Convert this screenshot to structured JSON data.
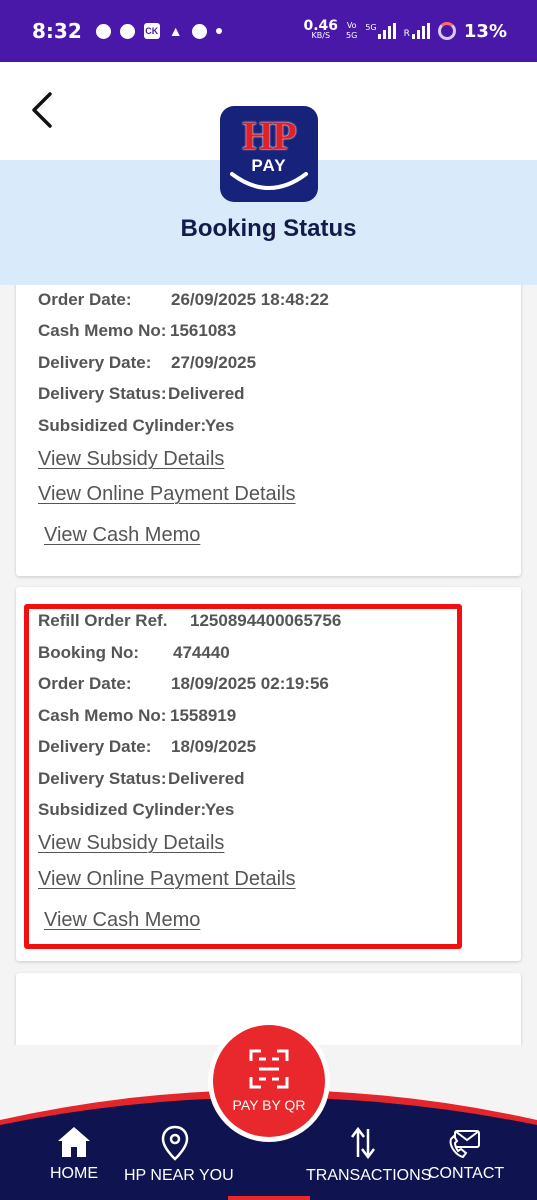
{
  "status_bar": {
    "time": "8:32",
    "speed_value": "0.46",
    "speed_unit": "KB/S",
    "vo_top": "Vo",
    "vo_bottom": "5G",
    "net_label": "5G",
    "roaming": "R",
    "battery": "13%",
    "notif_icons": [
      "chat-icon",
      "facebook-icon",
      "ck-app-icon",
      "drive-icon",
      "bag-icon"
    ]
  },
  "header": {
    "logo_top": "HP",
    "logo_bottom": "PAY",
    "title": "Booking Status"
  },
  "cards": [
    {
      "rows": [
        {
          "label": "Order Date:",
          "value": "26/09/2025 18:48:22"
        },
        {
          "label": "Cash Memo No:",
          "value": "1561083"
        },
        {
          "label": "Delivery Date:",
          "value": "27/09/2025"
        },
        {
          "label": "Delivery Status:",
          "value": "Delivered"
        },
        {
          "label": "Subsidized Cylinder:",
          "value": "Yes"
        }
      ],
      "links": {
        "subsidy": "View Subsidy Details",
        "online_payment": "View Online Payment Details",
        "cash_memo": "View Cash Memo"
      }
    },
    {
      "rows": [
        {
          "label": "Refill Order Ref.",
          "value": "1250894400065756"
        },
        {
          "label": "Booking No:",
          "value": "474440"
        },
        {
          "label": "Order Date:",
          "value": "18/09/2025 02:19:56"
        },
        {
          "label": "Cash Memo No:",
          "value": "1558919"
        },
        {
          "label": "Delivery Date:",
          "value": "18/09/2025"
        },
        {
          "label": "Delivery Status:",
          "value": "Delivered"
        },
        {
          "label": "Subsidized Cylinder:",
          "value": "Yes"
        }
      ],
      "links": {
        "subsidy": "View Subsidy Details",
        "online_payment": "View Online Payment Details",
        "cash_memo": "View Cash Memo"
      }
    }
  ],
  "bottom_nav": {
    "home": "HOME",
    "near_you": "HP NEAR YOU",
    "pay_by_qr": "PAY BY QR",
    "transactions": "TRANSACTIONS",
    "contact": "CONTACT"
  },
  "colors": {
    "status_bar": "#4a18a8",
    "header_band": "#d9ebfa",
    "brand_navy": "#17237a",
    "brand_red": "#e2202a",
    "highlight_box": "#f20f0f",
    "nav_bg": "#0f1450"
  }
}
